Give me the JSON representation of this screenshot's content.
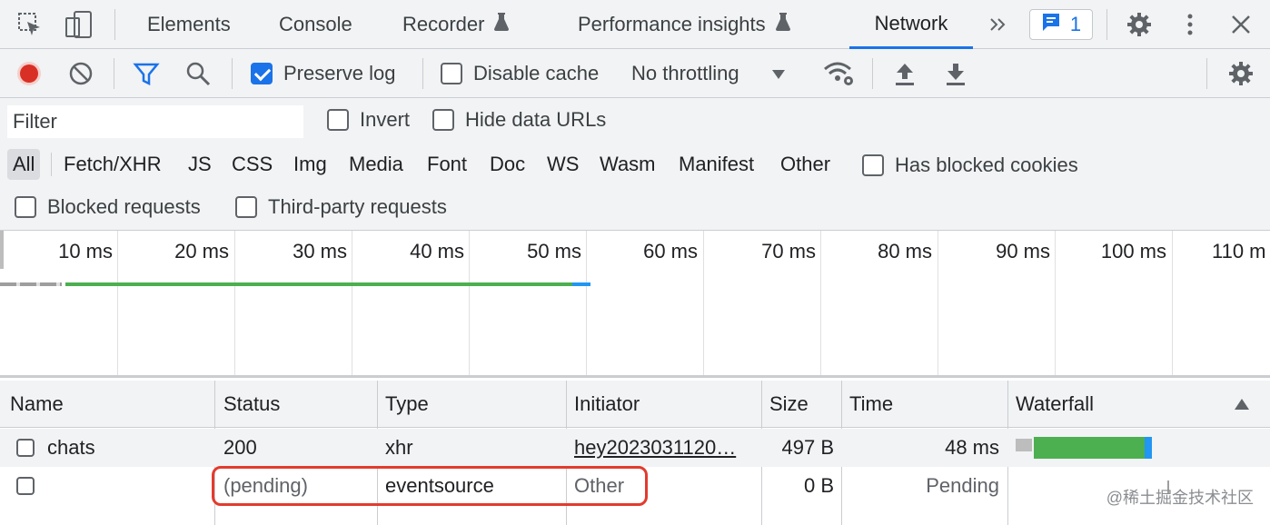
{
  "tabs": {
    "elements": "Elements",
    "console": "Console",
    "recorder": "Recorder",
    "performance_insights": "Performance insights",
    "network": "Network",
    "issues_count": "1"
  },
  "toolbar": {
    "preserve_log": "Preserve log",
    "disable_cache": "Disable cache",
    "throttling": "No throttling"
  },
  "filter": {
    "placeholder": "Filter",
    "invert": "Invert",
    "hide_data_urls": "Hide data URLs",
    "types": [
      "All",
      "Fetch/XHR",
      "JS",
      "CSS",
      "Img",
      "Media",
      "Font",
      "Doc",
      "WS",
      "Wasm",
      "Manifest",
      "Other"
    ],
    "has_blocked_cookies": "Has blocked cookies",
    "blocked_requests": "Blocked requests",
    "third_party_requests": "Third-party requests"
  },
  "overview": {
    "ticks": [
      "10 ms",
      "20 ms",
      "30 ms",
      "40 ms",
      "50 ms",
      "60 ms",
      "70 ms",
      "80 ms",
      "90 ms",
      "100 ms",
      "110 m"
    ]
  },
  "table": {
    "headers": {
      "name": "Name",
      "status": "Status",
      "type": "Type",
      "initiator": "Initiator",
      "size": "Size",
      "time": "Time",
      "waterfall": "Waterfall"
    },
    "rows": [
      {
        "name": "chats",
        "status": "200",
        "type": "xhr",
        "initiator": "hey2023031120…",
        "size": "497 B",
        "time": "48 ms"
      },
      {
        "name": "",
        "status": "(pending)",
        "type": "eventsource",
        "initiator": "Other",
        "size": "0 B",
        "time": "Pending"
      }
    ]
  },
  "watermark": "@稀土掘金技术社区",
  "colors": {
    "accent": "#1a73e8",
    "record": "#d93025",
    "waterfall_green": "#4caf50",
    "waterfall_blue": "#2196f3",
    "highlight": "#e23b2e"
  }
}
